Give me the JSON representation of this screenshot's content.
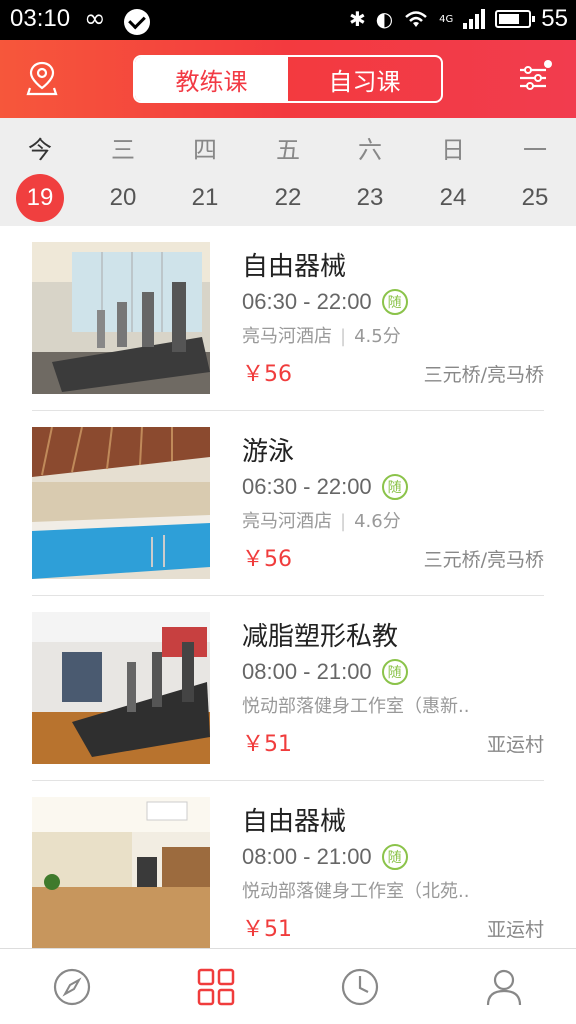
{
  "status_bar": {
    "time": "03:10",
    "battery_level": "55",
    "network": "4G"
  },
  "header": {
    "tabs": [
      {
        "label": "教练课",
        "active": true
      },
      {
        "label": "自习课",
        "active": false
      }
    ],
    "accent_color": "#f23a44"
  },
  "dates": [
    {
      "day": "今",
      "date": "19",
      "selected": true
    },
    {
      "day": "三",
      "date": "20",
      "selected": false
    },
    {
      "day": "四",
      "date": "21",
      "selected": false
    },
    {
      "day": "五",
      "date": "22",
      "selected": false
    },
    {
      "day": "六",
      "date": "23",
      "selected": false
    },
    {
      "day": "日",
      "date": "24",
      "selected": false
    },
    {
      "day": "一",
      "date": "25",
      "selected": false
    }
  ],
  "classes": [
    {
      "title": "自由器械",
      "time": "06:30 - 22:00",
      "badge": "随",
      "venue": "亮马河酒店",
      "rating": "4.5分",
      "price": "￥56",
      "area": "三元桥/亮马桥",
      "image": "gym-treadmills"
    },
    {
      "title": "游泳",
      "time": "06:30 - 22:00",
      "badge": "随",
      "venue": "亮马河酒店",
      "rating": "4.6分",
      "price": "￥56",
      "area": "三元桥/亮马桥",
      "image": "indoor-pool"
    },
    {
      "title": "减脂塑形私教",
      "time": "08:00 - 21:00",
      "badge": "随",
      "venue": "悦动部落健身工作室（惠新..",
      "rating": "",
      "price": "￥51",
      "area": "亚运村",
      "image": "gym-treadmills-red-floor"
    },
    {
      "title": "自由器械",
      "time": "08:00 - 21:00",
      "badge": "随",
      "venue": "悦动部落健身工作室（北苑..",
      "rating": "",
      "price": "￥51",
      "area": "亚运村",
      "image": "yoga-studio"
    }
  ],
  "bottom_nav": [
    {
      "icon": "compass-icon",
      "active": false
    },
    {
      "icon": "grid-icon",
      "active": true
    },
    {
      "icon": "clock-icon",
      "active": false
    },
    {
      "icon": "user-icon",
      "active": false
    }
  ]
}
